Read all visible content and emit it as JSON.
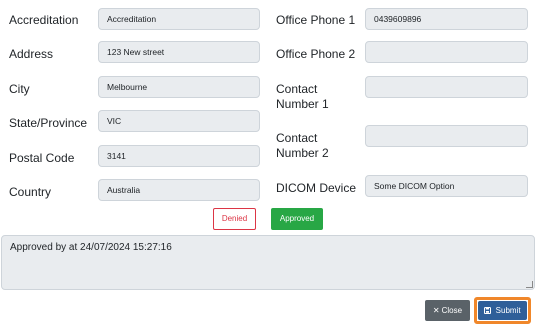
{
  "form": {
    "left": [
      {
        "label": "Accreditation",
        "value": "Accreditation"
      },
      {
        "label": "Address",
        "value": "123 New street"
      },
      {
        "label": "City",
        "value": "Melbourne"
      },
      {
        "label": "State/Province",
        "value": "VIC"
      },
      {
        "label": "Postal Code",
        "value": "3141"
      },
      {
        "label": "Country",
        "value": "Australia"
      }
    ],
    "right": [
      {
        "label": "Office Phone 1",
        "value": "0439609896"
      },
      {
        "label": "Office Phone 2",
        "value": ""
      },
      {
        "label_line1": "Contact",
        "label_line2": "Number 1",
        "value": ""
      },
      {
        "label_line1": "Contact",
        "label_line2": "Number 2",
        "value": ""
      },
      {
        "label": "DICOM Device",
        "value": "Some DICOM Option"
      }
    ]
  },
  "status": {
    "denied_label": "Denied",
    "approved_label": "Approved"
  },
  "note": {
    "text": "Approved by  at 24/07/2024 15:27:16"
  },
  "actions": {
    "close_label": "Close",
    "submit_label": "Submit"
  },
  "colors": {
    "approved": "#28a745",
    "denied": "#dc3545",
    "submit": "#2f5f99",
    "focus_ring": "#f0872a",
    "close": "#5a6268"
  },
  "icons": {
    "close": "x-icon",
    "submit": "save-icon"
  }
}
